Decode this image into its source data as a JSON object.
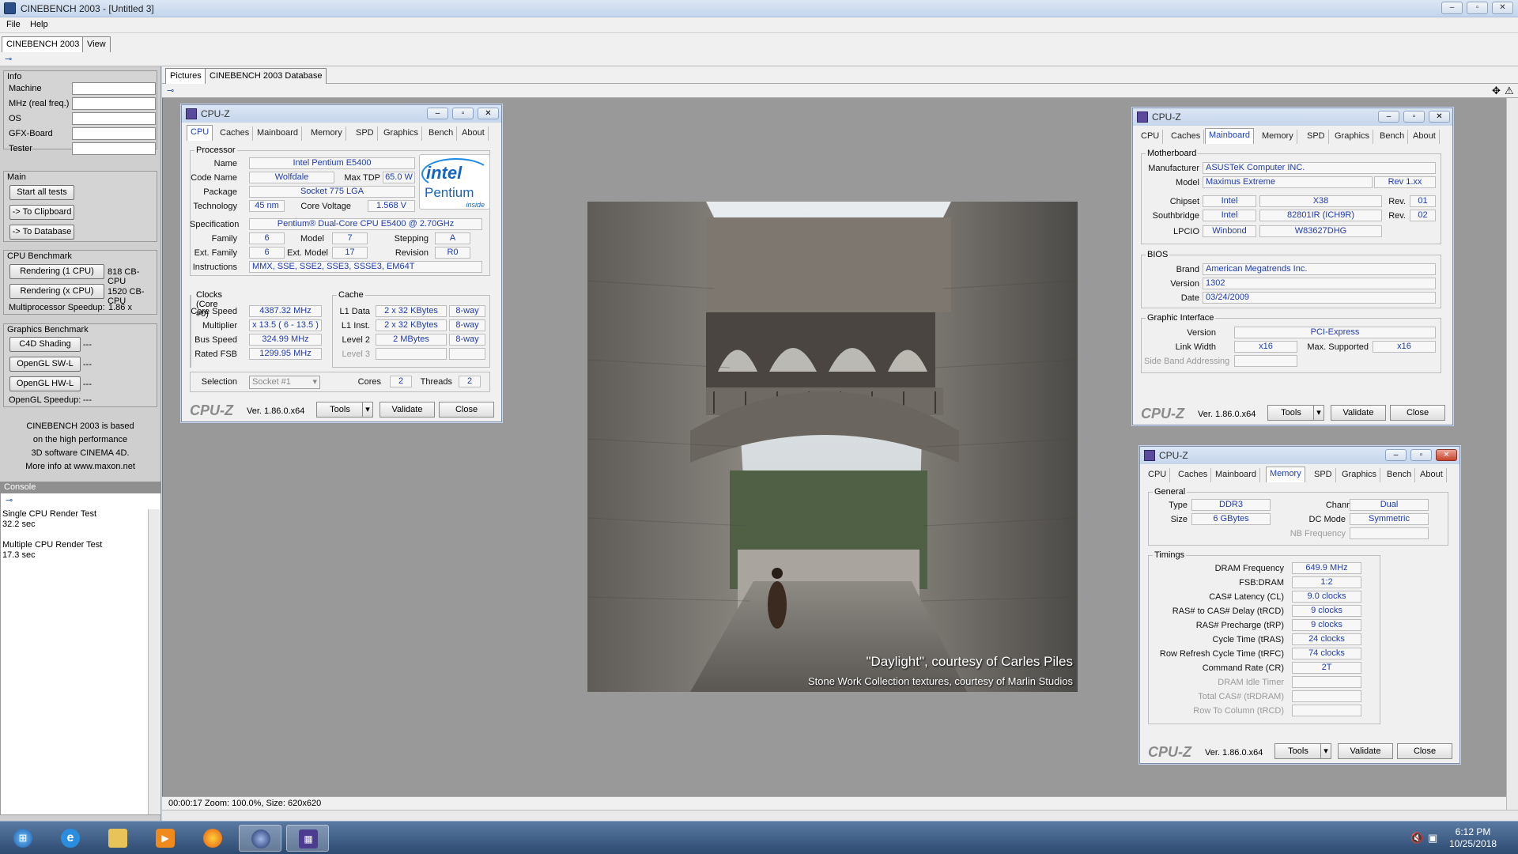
{
  "window": {
    "title": "CINEBENCH 2003 - [Untitled 3]",
    "min": "–",
    "max": "▫",
    "close": "✕"
  },
  "menu": [
    "File",
    "Help"
  ],
  "main_tabs": [
    "CINEBENCH 2003",
    "View"
  ],
  "left": {
    "info_title": "Info",
    "info_fields": [
      "Machine",
      "MHz (real freq.)",
      "OS",
      "GFX-Board",
      "Tester"
    ],
    "main_title": "Main",
    "start_all": "Start all tests",
    "to_clipboard": "-> To Clipboard",
    "to_database": "-> To Database",
    "cpu_title": "CPU Benchmark",
    "render1": "Rendering (1 CPU)",
    "render1_val": "818 CB-CPU",
    "renderx": "Rendering (x CPU)",
    "renderx_val": "1520 CB-CPU",
    "mp_speedup": "Multiprocessor Speedup:",
    "mp_val": "1.86 x",
    "gfx_title": "Graphics Benchmark",
    "c4d": "C4D Shading",
    "c4d_val": "---",
    "oglsw": "OpenGL SW-L",
    "oglsw_val": "---",
    "oglhw": "OpenGL HW-L",
    "oglhw_val": "---",
    "ogl_speedup": "OpenGL Speedup:",
    "ogl_val": "---",
    "about": [
      "CINEBENCH 2003 is based",
      "on the high performance",
      "3D software CINEMA 4D.",
      "More info at www.maxon.net"
    ],
    "console_title": "Console",
    "console_lines": [
      "Single CPU Render Test",
      "32.2 sec",
      "",
      "Multiple CPU Render Test",
      "17.3 sec"
    ]
  },
  "pic_tabs": [
    "Pictures",
    "CINEBENCH 2003 Database"
  ],
  "status": "00:00:17  Zoom: 100.0%, Size: 620x620",
  "render": {
    "caption1": "\"Daylight\", courtesy of Carles Piles",
    "caption2": "Stone Work Collection textures, courtesy of Marlin Studios"
  },
  "cpuz_common": {
    "title": "CPU-Z",
    "logo": "CPU-Z",
    "version": "Ver. 1.86.0.x64",
    "tools": "Tools",
    "validate": "Validate",
    "close": "Close",
    "tabs": [
      "CPU",
      "Caches",
      "Mainboard",
      "Memory",
      "SPD",
      "Graphics",
      "Bench",
      "About"
    ]
  },
  "cpu": {
    "processor_label": "Processor",
    "name_k": "Name",
    "name": "Intel Pentium E5400",
    "code_k": "Code Name",
    "code": "Wolfdale",
    "tdp_k": "Max TDP",
    "tdp": "65.0 W",
    "pkg_k": "Package",
    "pkg": "Socket 775 LGA",
    "tech_k": "Technology",
    "tech": "45 nm",
    "volt_k": "Core Voltage",
    "volt": "1.568 V",
    "spec_k": "Specification",
    "spec": "Pentium® Dual-Core  CPU     E5400  @ 2.70GHz",
    "fam_k": "Family",
    "fam": "6",
    "model_k": "Model",
    "model": "7",
    "step_k": "Stepping",
    "step": "A",
    "efam_k": "Ext. Family",
    "efam": "6",
    "emodel_k": "Ext. Model",
    "emodel": "17",
    "rev_k": "Revision",
    "rev": "R0",
    "instr_k": "Instructions",
    "instr": "MMX, SSE, SSE2, SSE3, SSSE3, EM64T",
    "clocks_label": "Clocks (Core #0)",
    "cs_k": "Core Speed",
    "cs": "4387.32 MHz",
    "mult_k": "Multiplier",
    "mult": "x 13.5 ( 6 - 13.5 )",
    "bus_k": "Bus Speed",
    "bus": "324.99 MHz",
    "fsb_k": "Rated FSB",
    "fsb": "1299.95 MHz",
    "cache_label": "Cache",
    "l1d_k": "L1 Data",
    "l1d": "2 x 32 KBytes",
    "l1d_w": "8-way",
    "l1i_k": "L1 Inst.",
    "l1i": "2 x 32 KBytes",
    "l1i_w": "8-way",
    "l2_k": "Level 2",
    "l2": "2 MBytes",
    "l2_w": "8-way",
    "l3_k": "Level 3",
    "sel_k": "Selection",
    "sel": "Socket #1",
    "cores_k": "Cores",
    "cores": "2",
    "threads_k": "Threads",
    "threads": "2",
    "intel_logo": "intel",
    "intel_brand": "Pentium",
    "intel_inside": "inside"
  },
  "mb": {
    "mb_label": "Motherboard",
    "man_k": "Manufacturer",
    "man": "ASUSTeK Computer INC.",
    "model_k": "Model",
    "model": "Maximus Extreme",
    "model_rev": "Rev 1.xx",
    "chip_k": "Chipset",
    "chip_v": "Intel",
    "chip_m": "X38",
    "chip_rk": "Rev.",
    "chip_r": "01",
    "sb_k": "Southbridge",
    "sb_v": "Intel",
    "sb_m": "82801IR (ICH9R)",
    "sb_rk": "Rev.",
    "sb_r": "02",
    "lpc_k": "LPCIO",
    "lpc_v": "Winbond",
    "lpc_m": "W83627DHG",
    "bios_label": "BIOS",
    "brand_k": "Brand",
    "brand": "American Megatrends Inc.",
    "ver_k": "Version",
    "ver": "1302",
    "date_k": "Date",
    "date": "03/24/2009",
    "gi_label": "Graphic Interface",
    "giver_k": "Version",
    "giver": "PCI-Express",
    "lw_k": "Link Width",
    "lw": "x16",
    "ms_k": "Max. Supported",
    "ms": "x16",
    "sba_k": "Side Band Addressing"
  },
  "mem": {
    "gen_label": "General",
    "type_k": "Type",
    "type": "DDR3",
    "ch_k": "Channel #",
    "ch": "Dual",
    "size_k": "Size",
    "size": "6 GBytes",
    "dc_k": "DC Mode",
    "dc": "Symmetric",
    "nb_k": "NB Frequency",
    "tim_label": "Timings",
    "t": [
      {
        "k": "DRAM Frequency",
        "v": "649.9 MHz"
      },
      {
        "k": "FSB:DRAM",
        "v": "1:2"
      },
      {
        "k": "CAS# Latency (CL)",
        "v": "9.0 clocks"
      },
      {
        "k": "RAS# to CAS# Delay (tRCD)",
        "v": "9 clocks"
      },
      {
        "k": "RAS# Precharge (tRP)",
        "v": "9 clocks"
      },
      {
        "k": "Cycle Time (tRAS)",
        "v": "24 clocks"
      },
      {
        "k": "Row Refresh Cycle Time (tRFC)",
        "v": "74 clocks"
      },
      {
        "k": "Command Rate (CR)",
        "v": "2T"
      },
      {
        "k": "DRAM Idle Timer",
        "v": ""
      },
      {
        "k": "Total CAS# (tRDRAM)",
        "v": ""
      },
      {
        "k": "Row To Column (tRCD)",
        "v": ""
      }
    ]
  },
  "clock": {
    "time": "6:12 PM",
    "date": "10/25/2018"
  }
}
